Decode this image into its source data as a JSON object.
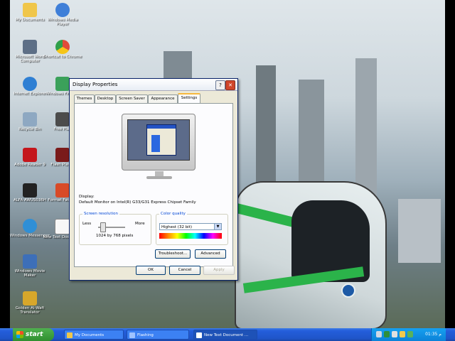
{
  "desktop": {
    "icons": [
      {
        "label": "My Documents",
        "color": "#f0c64a"
      },
      {
        "label": "Windows Media Player",
        "color": "#3f7fd8"
      },
      {
        "label": "Microsoft Word Computer",
        "color": "#5d6f86"
      },
      {
        "label": "Shortcut to Chrome",
        "color": "#e04b3a"
      },
      {
        "label": "Internet Explorer",
        "color": "#2f7fd3"
      },
      {
        "label": "Windows Firewall",
        "color": "#3ba15a"
      },
      {
        "label": "Recycle Bin",
        "color": "#8ea8c2"
      },
      {
        "label": "Free Play",
        "color": "#4c4c4c"
      },
      {
        "label": "Adobe Reader 9",
        "color": "#c4161c"
      },
      {
        "label": "Flash Player",
        "color": "#7a1a1a"
      },
      {
        "label": "ALFA AWUS036H",
        "color": "#222222"
      },
      {
        "label": "Format Factory",
        "color": "#d84a27"
      },
      {
        "label": "Windows Messenger",
        "color": "#2f8fd6"
      },
      {
        "label": "New Text Document",
        "color": "#f7f7f7"
      },
      {
        "label": "Windows Movie Maker",
        "color": "#3d6fb8"
      },
      {
        "label": "Golden Al-Wafi Translator",
        "color": "#d7a72b"
      }
    ]
  },
  "dialog": {
    "title": "Display Properties",
    "buttons": {
      "help": "?",
      "close": "✕"
    },
    "tabs": [
      "Themes",
      "Desktop",
      "Screen Saver",
      "Appearance",
      "Settings"
    ],
    "active_tab": "Settings",
    "display_label": "Display:",
    "display_value": "Default Monitor on Intel(R) G33/G31 Express Chipset Family",
    "screen_resolution": {
      "title": "Screen resolution",
      "less": "Less",
      "more": "More",
      "value": "1024 by 768 pixels",
      "slider_fraction": 0.15
    },
    "color_quality": {
      "title": "Color quality",
      "selected": "Highest (32 bit)"
    },
    "troubleshoot_label": "Troubleshoot...",
    "advanced_label": "Advanced",
    "ok_label": "OK",
    "cancel_label": "Cancel",
    "apply_label": "Apply"
  },
  "taskbar": {
    "start_label": "start",
    "tasks": [
      {
        "label": "My Documents"
      },
      {
        "label": "Flashing"
      },
      {
        "label": "New Text Document ..."
      }
    ],
    "clock": "01:35 م"
  }
}
